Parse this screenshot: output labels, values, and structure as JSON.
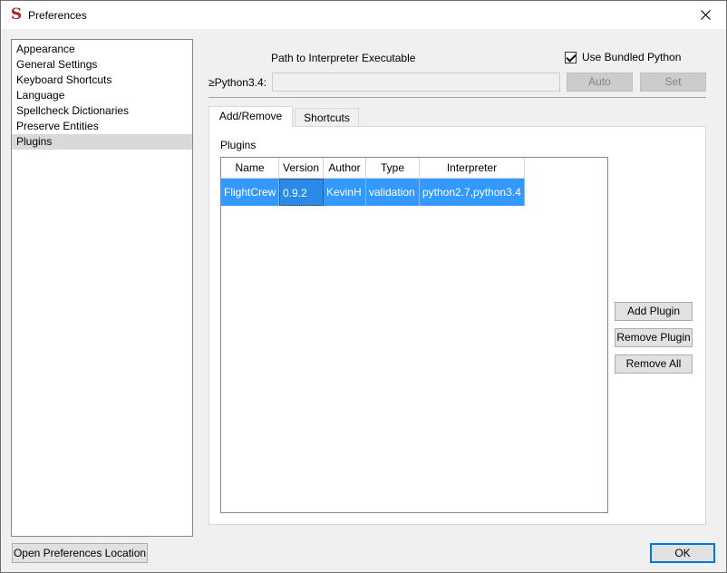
{
  "window": {
    "title": "Preferences"
  },
  "sidebar": {
    "items": [
      {
        "label": "Appearance",
        "selected": false
      },
      {
        "label": "General Settings",
        "selected": false
      },
      {
        "label": "Keyboard Shortcuts",
        "selected": false
      },
      {
        "label": "Language",
        "selected": false
      },
      {
        "label": "Spellcheck Dictionaries",
        "selected": false
      },
      {
        "label": "Preserve Entities",
        "selected": false
      },
      {
        "label": "Plugins",
        "selected": true
      }
    ]
  },
  "interpreter": {
    "path_label": "Path to Interpreter Executable",
    "use_bundled_label": "Use Bundled Python",
    "use_bundled_checked": true,
    "python_label": "≥Python3.4:",
    "path_value": "",
    "auto_label": "Auto",
    "set_label": "Set"
  },
  "tabs": [
    {
      "label": "Add/Remove",
      "active": true
    },
    {
      "label": "Shortcuts",
      "active": false
    }
  ],
  "plugins": {
    "heading": "Plugins",
    "columns": [
      "Name",
      "Version",
      "Author",
      "Type",
      "Interpreter"
    ],
    "rows": [
      {
        "name": "FlightCrew",
        "version": "0.9.2",
        "author": "KevinH",
        "type": "validation",
        "interpreter": "python2.7,python3.4",
        "selected": true
      }
    ],
    "add_label": "Add Plugin",
    "remove_label": "Remove Plugin",
    "remove_all_label": "Remove All"
  },
  "footer": {
    "open_location_label": "Open Preferences Location",
    "ok_label": "OK"
  },
  "icons": {
    "app": "sigil-logo-icon",
    "close": "close-icon",
    "check": "checkmark-icon"
  },
  "colors": {
    "selection": "#3399ff",
    "sidebar_selected": "#d9d9d9",
    "accent_border": "#0078d7",
    "app_icon": "#b0222a"
  }
}
